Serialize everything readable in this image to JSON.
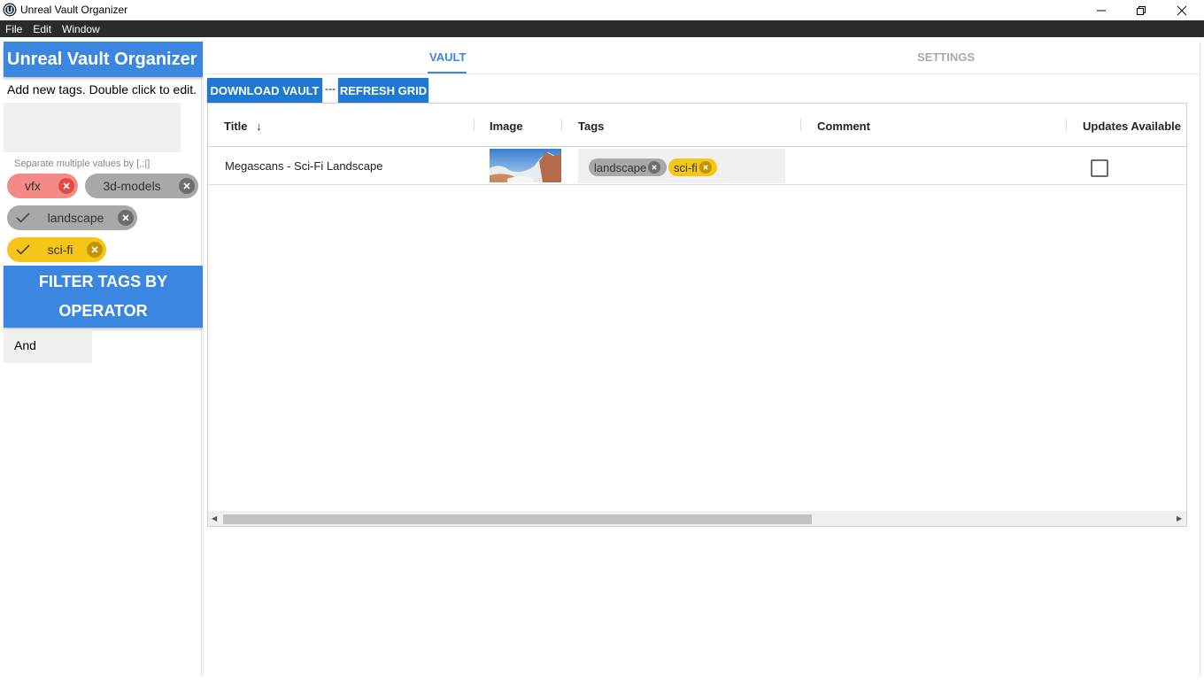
{
  "window": {
    "title": "Unreal Vault Organizer"
  },
  "menu": {
    "items": [
      "File",
      "Edit",
      "Window"
    ]
  },
  "sidebar": {
    "header": "Unreal Vault Organizer",
    "hint": "Add new tags. Double click to edit.",
    "tag_input_value": "",
    "separator_hint": "Separate multiple values by [,;|]",
    "chips": [
      {
        "label": "vfx",
        "selected": false,
        "color": "#f48a85"
      },
      {
        "label": "3d-models",
        "selected": false,
        "color": "#a8a8a8"
      },
      {
        "label": "landscape",
        "selected": true,
        "color": "#a8a8a8"
      },
      {
        "label": "sci-fi",
        "selected": true,
        "color": "#f5c518"
      }
    ],
    "filter_button": "FILTER TAGS BY OPERATOR",
    "operator_value": "And"
  },
  "tabs": [
    {
      "label": "VAULT",
      "active": true
    },
    {
      "label": "SETTINGS",
      "active": false
    }
  ],
  "toolbar": {
    "download_label": "DOWNLOAD VAULT",
    "separator": "---",
    "refresh_label": "REFRESH GRID"
  },
  "grid": {
    "columns": [
      "Title",
      "Image",
      "Tags",
      "Comment",
      "Updates Available"
    ],
    "sort_indicator": "↓",
    "rows": [
      {
        "title": "Megascans - Sci-Fi Landscape",
        "image": "landscape-thumbnail",
        "tags": [
          "landscape",
          "sci-fi"
        ],
        "comment": "",
        "updates_available": false
      }
    ]
  },
  "colors": {
    "accent": "#3b86e0",
    "button": "#1f78d1",
    "menubar": "#2b2b2b"
  }
}
